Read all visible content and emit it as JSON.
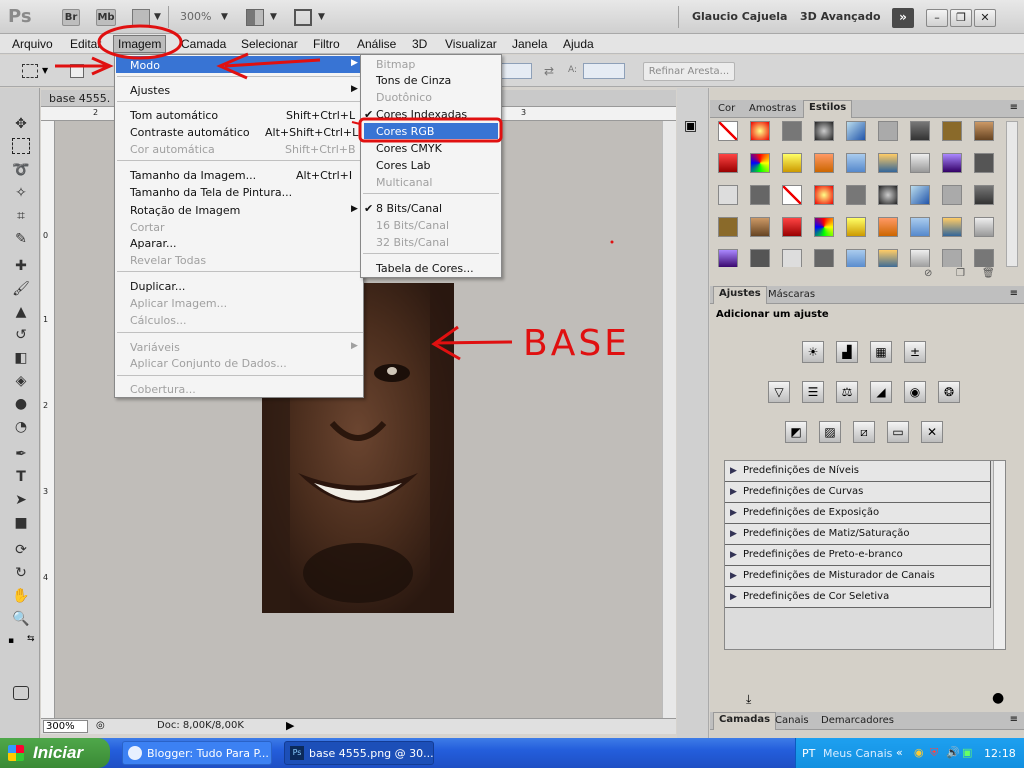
{
  "titlebar": {
    "logo": "Ps",
    "br": "Br",
    "mb": "Mb",
    "zoom": "300%",
    "user": "Glaucio Cajuela",
    "workspace": "3D Avançado",
    "min": "–",
    "restore": "❐",
    "close": "✕",
    "ext": "»"
  },
  "menubar": [
    "Arquivo",
    "Editar",
    "Imagem",
    "Camada",
    "Selecionar",
    "Filtro",
    "Análise",
    "3D",
    "Visualizar",
    "Janela",
    "Ajuda"
  ],
  "options": {
    "refinar": "Refinar Aresta...",
    "a_label": "A:"
  },
  "document": {
    "tab_name": "base 4555.",
    "zoom_field": "300%",
    "doc_info": "Doc: 8,00K/8,00K",
    "ruler_top": [
      "2",
      "3"
    ],
    "ruler_left": [
      "0",
      "1",
      "2",
      "3",
      "4"
    ]
  },
  "annotation": {
    "text": "BASE"
  },
  "imagem_menu": {
    "items": [
      {
        "label": "Modo",
        "shortcut": "",
        "disabled": false,
        "submenu": true,
        "highlight": true
      },
      {
        "label": "Ajustes",
        "shortcut": "",
        "disabled": false,
        "submenu": true
      },
      {
        "label": "Tom automático",
        "shortcut": "Shift+Ctrl+L",
        "disabled": false
      },
      {
        "label": "Contraste automático",
        "shortcut": "Alt+Shift+Ctrl+L",
        "disabled": false
      },
      {
        "label": "Cor automática",
        "shortcut": "Shift+Ctrl+B",
        "disabled": true
      },
      {
        "label": "Tamanho da Imagem...",
        "shortcut": "Alt+Ctrl+I",
        "disabled": false
      },
      {
        "label": "Tamanho da Tela de Pintura...",
        "shortcut": "",
        "disabled": false
      },
      {
        "label": "Rotação de Imagem",
        "shortcut": "",
        "disabled": false,
        "submenu": true
      },
      {
        "label": "Cortar",
        "shortcut": "",
        "disabled": true
      },
      {
        "label": "Aparar...",
        "shortcut": "",
        "disabled": false
      },
      {
        "label": "Revelar Todas",
        "shortcut": "",
        "disabled": true
      },
      {
        "label": "Duplicar...",
        "shortcut": "",
        "disabled": false
      },
      {
        "label": "Aplicar Imagem...",
        "shortcut": "",
        "disabled": true
      },
      {
        "label": "Cálculos...",
        "shortcut": "",
        "disabled": true
      },
      {
        "label": "Variáveis",
        "shortcut": "",
        "disabled": true,
        "submenu": true
      },
      {
        "label": "Aplicar Conjunto de Dados...",
        "shortcut": "",
        "disabled": true
      },
      {
        "label": "Cobertura...",
        "shortcut": "",
        "disabled": true
      }
    ]
  },
  "modo_menu": {
    "items": [
      {
        "label": "Bitmap",
        "disabled": true,
        "checked": false
      },
      {
        "label": "Tons de Cinza",
        "disabled": false,
        "checked": false
      },
      {
        "label": "Duotônico",
        "disabled": true,
        "checked": false
      },
      {
        "label": "Cores Indexadas",
        "disabled": false,
        "checked": true
      },
      {
        "label": "Cores RGB",
        "disabled": false,
        "checked": false,
        "highlight": true
      },
      {
        "label": "Cores CMYK",
        "disabled": false,
        "checked": false
      },
      {
        "label": "Cores Lab",
        "disabled": false,
        "checked": false
      },
      {
        "label": "Multicanal",
        "disabled": true,
        "checked": false
      },
      {
        "label": "8 Bits/Canal",
        "disabled": false,
        "checked": true
      },
      {
        "label": "16 Bits/Canal",
        "disabled": true,
        "checked": false
      },
      {
        "label": "32 Bits/Canal",
        "disabled": true,
        "checked": false
      },
      {
        "label": "Tabela de Cores...",
        "disabled": false,
        "checked": false
      }
    ]
  },
  "panels": {
    "top_tabs": [
      "Cor",
      "Amostras",
      "Estilos"
    ],
    "mid_tabs": [
      "Ajustes",
      "Máscaras"
    ],
    "adjust_title": "Adicionar um ajuste",
    "presets": [
      "Predefinições de Níveis",
      "Predefinições de Curvas",
      "Predefinições de Exposição",
      "Predefinições de Matiz/Saturação",
      "Predefinições de Preto-e-branco",
      "Predefinições de Misturador de Canais",
      "Predefinições de Cor Seletiva"
    ],
    "bottom_tabs": [
      "Camadas",
      "Canais",
      "Demarcadores"
    ]
  },
  "taskbar": {
    "start": "Iniciar",
    "tasks": [
      "Blogger: Tudo Para P...",
      "base 4555.png @ 30..."
    ],
    "lang": "PT",
    "tray_label": "Meus Canais",
    "clock": "12:18"
  },
  "colors": {
    "highlight": "#3874d4",
    "annotation_red": "#e01010",
    "foreground": "#ff0000"
  }
}
